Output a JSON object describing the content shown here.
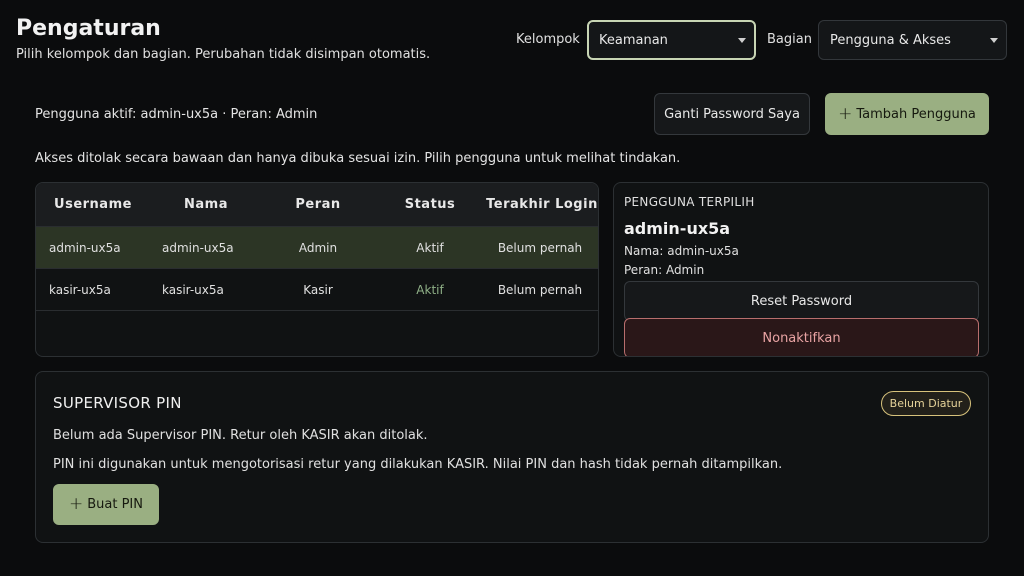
{
  "header": {
    "title": "Pengaturan",
    "subtitle": "Pilih kelompok dan bagian. Perubahan tidak disimpan otomatis.",
    "group_label": "Kelompok",
    "group_value": "Keamanan",
    "section_label": "Bagian",
    "section_value": "Pengguna & Akses"
  },
  "toolbar": {
    "active_user_text": "Pengguna aktif: admin-ux5a · Peran: Admin",
    "change_password_label": "Ganti Password Saya",
    "add_user_label": "Tambah Pengguna",
    "info_text": "Akses ditolak secara bawaan dan hanya dibuka sesuai izin. Pilih pengguna untuk melihat tindakan."
  },
  "table": {
    "columns": [
      "Username",
      "Nama",
      "Peran",
      "Status",
      "Terakhir Login"
    ],
    "rows": [
      [
        "admin-ux5a",
        "admin-ux5a",
        "Admin",
        "Aktif",
        "Belum pernah"
      ],
      [
        "kasir-ux5a",
        "kasir-ux5a",
        "Kasir",
        "Aktif",
        "Belum pernah"
      ]
    ]
  },
  "selected_user": {
    "heading": "PENGGUNA TERPILIH",
    "username": "admin-ux5a",
    "name_line": "Nama: admin-ux5a",
    "role_line": "Peran: Admin",
    "reset_label": "Reset Password",
    "deactivate_label": "Nonaktifkan"
  },
  "supervisor_pin": {
    "title": "SUPERVISOR PIN",
    "badge": "Belum Diatur",
    "status_text": "Belum ada Supervisor PIN. Retur oleh KASIR akan ditolak.",
    "description": "PIN ini digunakan untuk mengotorisasi retur yang dilakukan KASIR. Nilai PIN dan hash tidak pernah ditampilkan.",
    "create_label": "Buat PIN"
  },
  "colors": {
    "accent_green": "#9aaf82",
    "danger_border": "#b86e6d",
    "warning_badge": "#d7c27c",
    "selected_row": "#2c3525"
  }
}
